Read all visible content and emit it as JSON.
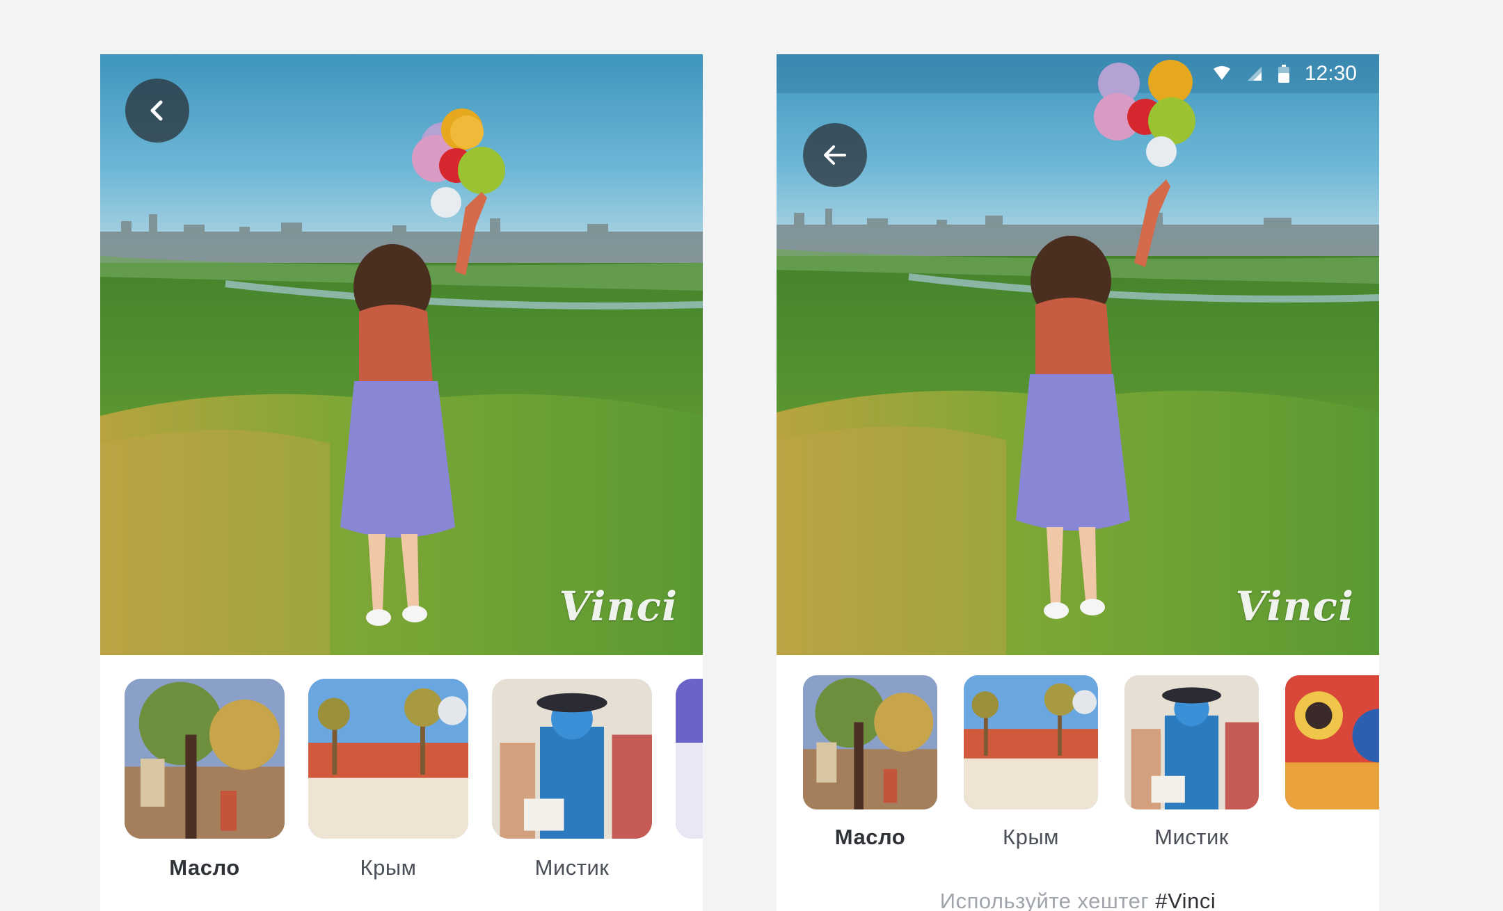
{
  "left_screen": {
    "watermark": "Vinci",
    "filters": [
      {
        "label": "Масло",
        "active": true
      },
      {
        "label": "Крым",
        "active": false
      },
      {
        "label": "Мистик",
        "active": false
      }
    ]
  },
  "right_screen": {
    "status_bar": {
      "time": "12:30"
    },
    "watermark": "Vinci",
    "filters": [
      {
        "label": "Масло",
        "active": true
      },
      {
        "label": "Крым",
        "active": false
      },
      {
        "label": "Мистик",
        "active": false
      }
    ],
    "hint": {
      "text": "Используйте хештег",
      "hashtag": "#Vinci"
    }
  },
  "icons": {
    "back_left": "chevron-left-icon",
    "back_right": "arrow-left-icon",
    "wifi": "wifi-icon",
    "signal": "signal-icon",
    "battery": "battery-icon"
  },
  "colors": {
    "background": "#f2f3f5",
    "sky": "#4fa3c9",
    "grass": "#5b8f2c",
    "skirt": "#8a86d6",
    "label_active": "#2f3338",
    "hint_gray": "#a0a5ab"
  }
}
